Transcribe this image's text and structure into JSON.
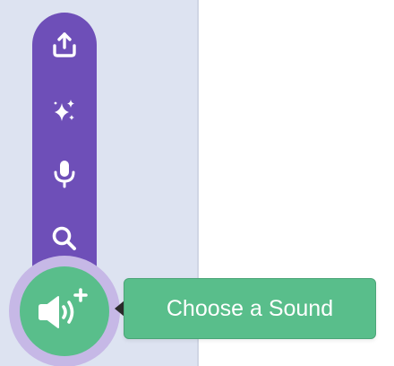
{
  "colors": {
    "pane_background": "#dde3f1",
    "menu_purple": "#6e4fb8",
    "ring_lavender": "#c6b8e6",
    "accent_green": "#59be8b",
    "icon_white": "#ffffff"
  },
  "menu": {
    "items": [
      {
        "name": "upload-sound",
        "icon": "upload-icon"
      },
      {
        "name": "surprise",
        "icon": "sparkles-icon"
      },
      {
        "name": "record",
        "icon": "microphone-icon"
      },
      {
        "name": "choose",
        "icon": "search-icon"
      }
    ],
    "main_icon": "speaker-plus-icon"
  },
  "tooltip": {
    "label": "Choose a Sound"
  }
}
